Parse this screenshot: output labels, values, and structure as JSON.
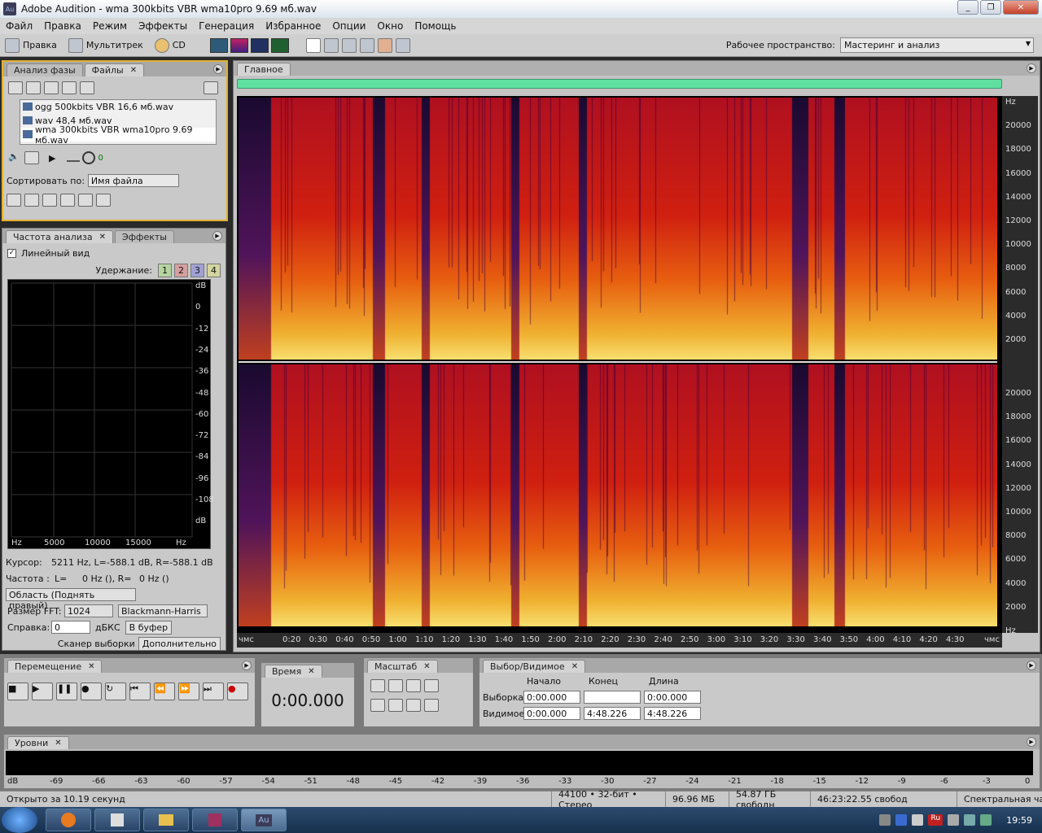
{
  "window": {
    "title": "Adobe Audition - wma 300kbits VBR wma10pro 9.69 мб.wav",
    "app_icon": "Au"
  },
  "menu": [
    "Файл",
    "Правка",
    "Режим",
    "Эффекты",
    "Генерация",
    "Избранное",
    "Опции",
    "Окно",
    "Помощь"
  ],
  "toolbar": {
    "edit_label": "Правка",
    "multitrack_label": "Мультитрек",
    "cd_label": "CD",
    "workspace_label": "Рабочее пространство:",
    "workspace_value": "Мастеринг и анализ"
  },
  "files_panel": {
    "tabs": [
      "Анализ фазы",
      "Файлы"
    ],
    "files": [
      "ogg 500kbits VBR 16,6 мб.wav",
      "wav 48,4 мб.wav",
      "wma 300kbits VBR wma10pro 9.69 мб.wav"
    ],
    "volume_value": "0",
    "sort_label": "Сортировать по:",
    "sort_value": "Имя файла"
  },
  "analysis_panel": {
    "tabs": [
      "Частота  анализа",
      "Эффекты"
    ],
    "linear_view_label": "Линейный вид",
    "hold_label": "Удержание:",
    "hold_buttons": [
      "1",
      "2",
      "3",
      "4"
    ],
    "db_ticks": [
      "dB",
      "0",
      "-12",
      "-24",
      "-36",
      "-48",
      "-60",
      "-72",
      "-84",
      "-96",
      "-108",
      "dB"
    ],
    "hz_ticks": [
      "Hz",
      "5000",
      "10000",
      "15000",
      "Hz"
    ],
    "cursor_label": "Курсор:",
    "cursor_value": "5211 Hz, L=-588.1 dB, R=-588.1 dB",
    "freq_label": "Частота :",
    "freq_L": "L=",
    "freq_value": "0 Hz (),  R=",
    "freq_value2": "0 Hz ()",
    "area_value": "Область (Поднять правый)",
    "fft_label": "Размер FFT:",
    "fft_value": "1024",
    "window_value": "Blackmann-Harris",
    "ref_label": "Справка:",
    "ref_value": "0",
    "ref_unit": "дБКС",
    "copy_btn": "В буфер",
    "scan_btn": "Сканер выборки",
    "more_btn": "Дополнительно"
  },
  "editor": {
    "tab": "Главное",
    "hz_ticks": [
      "Hz",
      "20000",
      "18000",
      "16000",
      "14000",
      "12000",
      "10000",
      "8000",
      "6000",
      "4000",
      "2000"
    ],
    "hz_ticks2": [
      "20000",
      "18000",
      "16000",
      "14000",
      "12000",
      "10000",
      "8000",
      "6000",
      "4000",
      "2000",
      "Hz"
    ],
    "time_ticks": [
      "чмс",
      "0:20",
      "0:30",
      "0:40",
      "0:50",
      "1:00",
      "1:10",
      "1:20",
      "1:30",
      "1:40",
      "1:50",
      "2:00",
      "2:10",
      "2:20",
      "2:30",
      "2:40",
      "2:50",
      "3:00",
      "3:10",
      "3:20",
      "3:30",
      "3:40",
      "3:50",
      "4:00",
      "4:10",
      "4:20",
      "4:30",
      "чмс"
    ]
  },
  "transport": {
    "tab": "Перемещение"
  },
  "time": {
    "tab": "Время",
    "value": "0:00.000"
  },
  "zoom": {
    "tab": "Масштаб"
  },
  "selection": {
    "tab": "Выбор/Видимое",
    "cols": [
      "Начало",
      "Конец",
      "Длина"
    ],
    "rows": [
      {
        "label": "Выборка",
        "start": "0:00.000",
        "end": "",
        "length": "0:00.000"
      },
      {
        "label": "Видимое",
        "start": "0:00.000",
        "end": "4:48.226",
        "length": "4:48.226"
      }
    ]
  },
  "levels": {
    "tab": "Уровни",
    "ticks": [
      "dB",
      "-69",
      "-66",
      "-63",
      "-60",
      "-57",
      "-54",
      "-51",
      "-48",
      "-45",
      "-42",
      "-39",
      "-36",
      "-33",
      "-30",
      "-27",
      "-24",
      "-21",
      "-18",
      "-15",
      "-12",
      "-9",
      "-6",
      "-3",
      "0"
    ]
  },
  "status": {
    "opened": "Открыто за 10.19 секунд",
    "format": "44100 • 32-бит • Стерео",
    "size": "96.96 МБ",
    "free": "54.87 ГБ свободн",
    "time_free": "46:23:22.55 свобод",
    "view": "Спектральная час"
  },
  "taskbar": {
    "clock": "19:59",
    "lang": "Ru",
    "active_app": "Au"
  }
}
